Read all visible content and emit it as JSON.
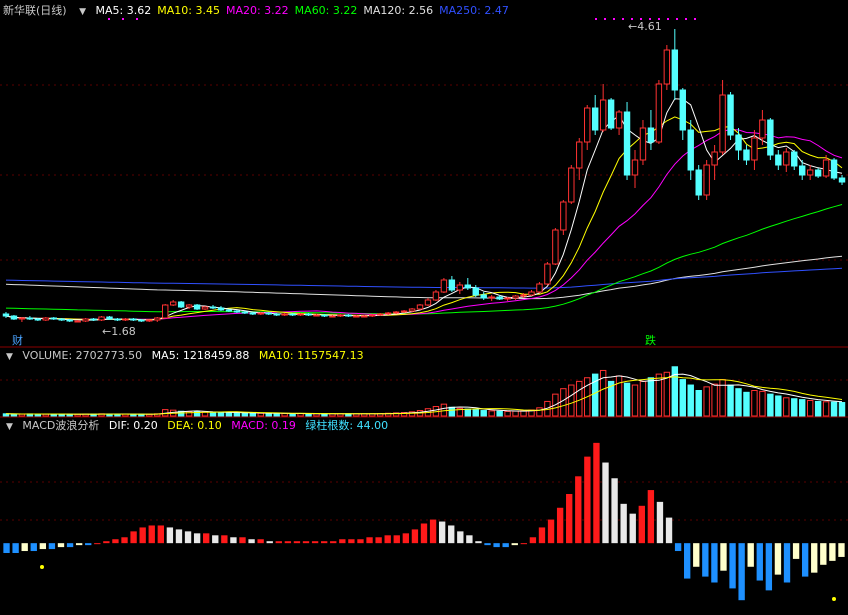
{
  "main": {
    "title": "新华联(日线)",
    "ma": [
      {
        "label": "MA5: 3.62",
        "color": "#ffffff"
      },
      {
        "label": "MA10: 3.45",
        "color": "#ffff00"
      },
      {
        "label": "MA20: 3.22",
        "color": "#ff00ff"
      },
      {
        "label": "MA60: 3.22",
        "color": "#00ff00"
      },
      {
        "label": "MA120: 2.56",
        "color": "#e0e0e0"
      },
      {
        "label": "MA250: 2.47",
        "color": "#3050ff"
      }
    ],
    "high_label": "4.61",
    "low_label": "1.68",
    "markers": [
      {
        "text": "财",
        "color": "#4aa3ff"
      },
      {
        "text": "跌",
        "color": "#00ff00"
      }
    ]
  },
  "volume": {
    "title": "VOLUME: 2702773.50",
    "ma5": "MA5: 1218459.88",
    "ma10": "MA10: 1157547.13"
  },
  "macd": {
    "title": "MACD波浪分析",
    "dif": "DIF: 0.20",
    "dea": "DEA: 0.10",
    "macd": "MACD: 0.19",
    "count": "绿柱根数: 44.00"
  },
  "chart_data": {
    "type": "candlestick",
    "price_range": [
      1.6,
      4.7
    ],
    "candles": [
      [
        1.76,
        1.78,
        1.72,
        1.74
      ],
      [
        1.74,
        1.75,
        1.7,
        1.71
      ],
      [
        1.71,
        1.73,
        1.68,
        1.72
      ],
      [
        1.72,
        1.74,
        1.7,
        1.71
      ],
      [
        1.71,
        1.72,
        1.69,
        1.7
      ],
      [
        1.7,
        1.73,
        1.69,
        1.72
      ],
      [
        1.72,
        1.73,
        1.7,
        1.71
      ],
      [
        1.71,
        1.72,
        1.69,
        1.7
      ],
      [
        1.7,
        1.71,
        1.68,
        1.69
      ],
      [
        1.69,
        1.7,
        1.68,
        1.69
      ],
      [
        1.69,
        1.72,
        1.68,
        1.71
      ],
      [
        1.71,
        1.72,
        1.69,
        1.7
      ],
      [
        1.7,
        1.74,
        1.69,
        1.73
      ],
      [
        1.73,
        1.74,
        1.7,
        1.71
      ],
      [
        1.71,
        1.72,
        1.69,
        1.7
      ],
      [
        1.7,
        1.72,
        1.69,
        1.71
      ],
      [
        1.71,
        1.72,
        1.69,
        1.7
      ],
      [
        1.7,
        1.71,
        1.68,
        1.69
      ],
      [
        1.69,
        1.7,
        1.68,
        1.7
      ],
      [
        1.7,
        1.73,
        1.68,
        1.72
      ],
      [
        1.72,
        1.86,
        1.72,
        1.85
      ],
      [
        1.85,
        1.9,
        1.84,
        1.88
      ],
      [
        1.88,
        1.89,
        1.82,
        1.83
      ],
      [
        1.83,
        1.86,
        1.81,
        1.85
      ],
      [
        1.85,
        1.86,
        1.8,
        1.81
      ],
      [
        1.81,
        1.84,
        1.8,
        1.83
      ],
      [
        1.83,
        1.85,
        1.81,
        1.82
      ],
      [
        1.82,
        1.84,
        1.79,
        1.8
      ],
      [
        1.8,
        1.81,
        1.78,
        1.79
      ],
      [
        1.79,
        1.8,
        1.77,
        1.78
      ],
      [
        1.78,
        1.79,
        1.76,
        1.77
      ],
      [
        1.77,
        1.78,
        1.75,
        1.76
      ],
      [
        1.76,
        1.78,
        1.75,
        1.77
      ],
      [
        1.77,
        1.78,
        1.75,
        1.76
      ],
      [
        1.76,
        1.77,
        1.74,
        1.75
      ],
      [
        1.75,
        1.77,
        1.74,
        1.76
      ],
      [
        1.76,
        1.77,
        1.74,
        1.75
      ],
      [
        1.75,
        1.77,
        1.74,
        1.76
      ],
      [
        1.76,
        1.77,
        1.74,
        1.75
      ],
      [
        1.75,
        1.76,
        1.74,
        1.75
      ],
      [
        1.75,
        1.76,
        1.73,
        1.74
      ],
      [
        1.74,
        1.75,
        1.73,
        1.74
      ],
      [
        1.74,
        1.76,
        1.73,
        1.75
      ],
      [
        1.75,
        1.76,
        1.73,
        1.74
      ],
      [
        1.74,
        1.75,
        1.73,
        1.74
      ],
      [
        1.74,
        1.75,
        1.73,
        1.74
      ],
      [
        1.74,
        1.76,
        1.73,
        1.75
      ],
      [
        1.75,
        1.77,
        1.74,
        1.76
      ],
      [
        1.76,
        1.78,
        1.75,
        1.77
      ],
      [
        1.77,
        1.79,
        1.76,
        1.78
      ],
      [
        1.78,
        1.8,
        1.77,
        1.79
      ],
      [
        1.79,
        1.82,
        1.78,
        1.81
      ],
      [
        1.81,
        1.86,
        1.8,
        1.85
      ],
      [
        1.85,
        1.92,
        1.84,
        1.9
      ],
      [
        1.9,
        2.0,
        1.89,
        1.98
      ],
      [
        1.98,
        2.12,
        1.97,
        2.1
      ],
      [
        2.1,
        2.14,
        1.98,
        2.0
      ],
      [
        2.0,
        2.08,
        1.96,
        2.05
      ],
      [
        2.05,
        2.12,
        2.0,
        2.02
      ],
      [
        2.02,
        2.05,
        1.93,
        1.95
      ],
      [
        1.95,
        1.98,
        1.9,
        1.92
      ],
      [
        1.92,
        1.95,
        1.89,
        1.93
      ],
      [
        1.93,
        1.95,
        1.9,
        1.91
      ],
      [
        1.91,
        1.93,
        1.89,
        1.92
      ],
      [
        1.92,
        1.95,
        1.9,
        1.94
      ],
      [
        1.94,
        1.97,
        1.92,
        1.95
      ],
      [
        1.95,
        2.0,
        1.94,
        1.98
      ],
      [
        1.98,
        2.08,
        1.97,
        2.06
      ],
      [
        2.06,
        2.28,
        2.05,
        2.26
      ],
      [
        2.26,
        2.62,
        2.25,
        2.6
      ],
      [
        2.6,
        2.9,
        2.55,
        2.88
      ],
      [
        2.88,
        3.25,
        2.86,
        3.22
      ],
      [
        3.22,
        3.52,
        3.1,
        3.48
      ],
      [
        3.48,
        3.85,
        3.4,
        3.82
      ],
      [
        3.82,
        3.95,
        3.55,
        3.6
      ],
      [
        3.6,
        4.06,
        3.58,
        3.9
      ],
      [
        3.9,
        3.92,
        3.6,
        3.62
      ],
      [
        3.62,
        3.8,
        3.55,
        3.78
      ],
      [
        3.78,
        3.88,
        3.1,
        3.15
      ],
      [
        3.15,
        3.4,
        3.02,
        3.3
      ],
      [
        3.3,
        3.7,
        3.25,
        3.62
      ],
      [
        3.62,
        3.8,
        3.4,
        3.48
      ],
      [
        3.48,
        4.1,
        3.46,
        4.06
      ],
      [
        4.06,
        4.45,
        4.0,
        4.4
      ],
      [
        4.4,
        4.61,
        3.9,
        4.0
      ],
      [
        4.0,
        4.02,
        3.5,
        3.6
      ],
      [
        3.6,
        3.7,
        3.1,
        3.2
      ],
      [
        3.2,
        3.25,
        2.9,
        2.95
      ],
      [
        2.95,
        3.3,
        2.9,
        3.25
      ],
      [
        3.25,
        3.45,
        3.1,
        3.38
      ],
      [
        3.38,
        4.1,
        3.35,
        3.95
      ],
      [
        3.95,
        3.98,
        3.5,
        3.55
      ],
      [
        3.55,
        3.62,
        3.3,
        3.4
      ],
      [
        3.4,
        3.45,
        3.25,
        3.3
      ],
      [
        3.3,
        3.6,
        3.2,
        3.52
      ],
      [
        3.52,
        3.8,
        3.45,
        3.7
      ],
      [
        3.7,
        3.72,
        3.3,
        3.35
      ],
      [
        3.35,
        3.4,
        3.2,
        3.25
      ],
      [
        3.25,
        3.42,
        3.18,
        3.38
      ],
      [
        3.38,
        3.4,
        3.2,
        3.24
      ],
      [
        3.24,
        3.3,
        3.1,
        3.15
      ],
      [
        3.15,
        3.25,
        3.1,
        3.2
      ],
      [
        3.2,
        3.22,
        3.12,
        3.14
      ],
      [
        3.14,
        3.35,
        3.12,
        3.3
      ],
      [
        3.3,
        3.32,
        3.1,
        3.12
      ],
      [
        3.12,
        3.15,
        3.05,
        3.08
      ]
    ],
    "volume_range": [
      0,
      2800000
    ],
    "volumes": [
      120000,
      110000,
      100000,
      115000,
      105000,
      100000,
      110000,
      100000,
      95000,
      95000,
      110000,
      105000,
      120000,
      110000,
      100000,
      105000,
      100000,
      95000,
      95000,
      120000,
      350000,
      320000,
      260000,
      240000,
      220000,
      210000,
      200000,
      190000,
      180000,
      170000,
      160000,
      150000,
      150000,
      140000,
      140000,
      135000,
      130000,
      130000,
      125000,
      125000,
      120000,
      120000,
      125000,
      120000,
      118000,
      120000,
      125000,
      135000,
      150000,
      170000,
      190000,
      230000,
      300000,
      400000,
      520000,
      650000,
      480000,
      420000,
      380000,
      350000,
      300000,
      280000,
      260000,
      250000,
      270000,
      290000,
      330000,
      450000,
      800000,
      1200000,
      1500000,
      1700000,
      1900000,
      2100000,
      2300000,
      2500000,
      1900000,
      2200000,
      1800000,
      1700000,
      1900000,
      2100000,
      2300000,
      2400000,
      2702773,
      2000000,
      1700000,
      1400000,
      1600000,
      1750000,
      2000000,
      1700000,
      1500000,
      1300000,
      1400000,
      1350000,
      1200000,
      1100000,
      1000000,
      950000,
      900000,
      850000,
      800000,
      780000,
      760000,
      740000
    ],
    "macd_range": [
      -0.35,
      0.55
    ],
    "macd_hist": [
      -0.05,
      -0.05,
      -0.04,
      -0.04,
      -0.03,
      -0.03,
      -0.02,
      -0.02,
      -0.01,
      -0.01,
      0.0,
      0.01,
      0.02,
      0.03,
      0.06,
      0.08,
      0.09,
      0.09,
      0.08,
      0.07,
      0.06,
      0.05,
      0.05,
      0.04,
      0.04,
      0.03,
      0.03,
      0.02,
      0.02,
      0.01,
      0.01,
      0.01,
      0.01,
      0.01,
      0.01,
      0.01,
      0.01,
      0.02,
      0.02,
      0.02,
      0.03,
      0.03,
      0.04,
      0.04,
      0.05,
      0.07,
      0.1,
      0.12,
      0.11,
      0.09,
      0.06,
      0.04,
      0.01,
      -0.01,
      -0.02,
      -0.02,
      -0.01,
      0.0,
      0.03,
      0.08,
      0.12,
      0.18,
      0.25,
      0.34,
      0.44,
      0.51,
      0.41,
      0.33,
      0.2,
      0.15,
      0.19,
      0.27,
      0.21,
      0.13,
      -0.04,
      -0.18,
      -0.12,
      -0.17,
      -0.2,
      -0.14,
      -0.23,
      -0.29,
      -0.12,
      -0.19,
      -0.24,
      -0.16,
      -0.2,
      -0.08,
      -0.17,
      -0.15,
      -0.11,
      -0.09,
      -0.07
    ],
    "marks": {
      "high_index": 84,
      "low_index": 18
    }
  }
}
